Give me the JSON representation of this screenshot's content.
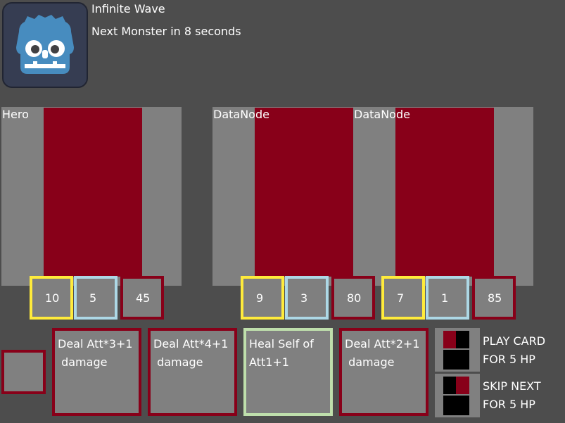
{
  "header": {
    "title": "Infinite Wave",
    "subtitle": "Next Monster in 8 seconds"
  },
  "logo": {
    "icon": "godot-robot-icon"
  },
  "units": [
    {
      "name": "Hero",
      "att": "10",
      "def": "5",
      "hp": "45"
    },
    {
      "name": "DataNode",
      "att": "9",
      "def": "3",
      "hp": "80"
    },
    {
      "name": "DataNode",
      "att": "7",
      "def": "1",
      "hp": "85"
    }
  ],
  "cards": [
    {
      "text": "Deal Att*3+1\n damage",
      "kind": "damage"
    },
    {
      "text": "Deal Att*4+1\n damage",
      "kind": "damage"
    },
    {
      "text": "Heal Self of\nAtt1+1",
      "kind": "heal"
    },
    {
      "text": "Deal Att*2+1\n damage",
      "kind": "damage"
    }
  ],
  "actions": {
    "play": {
      "label": "PLAY CARD\nFOR 5 HP",
      "icon": "play-card-icon"
    },
    "skip": {
      "label": "SKIP NEXT\nFOR 5 HP",
      "icon": "skip-next-icon"
    }
  },
  "colors": {
    "background": "#4d4d4d",
    "panel": "#808080",
    "accent_red": "#880019",
    "attack": "#ffeb3b",
    "defense": "#add8e6",
    "heal": "#bfdfac"
  }
}
